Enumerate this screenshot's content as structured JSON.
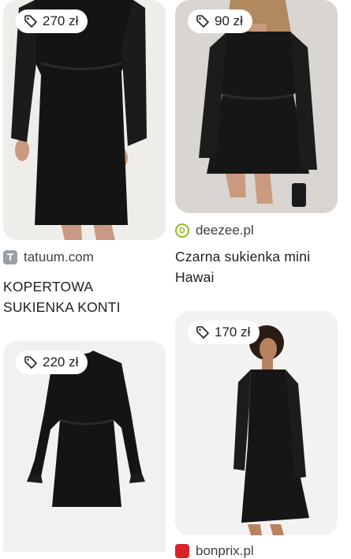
{
  "results": [
    {
      "price": "270 zł",
      "source": "tatuum.com",
      "title": "KOPERTOWA SUKIENKA KONTI",
      "favicon_color": "#9aa0a6"
    },
    {
      "price": "90 zł",
      "source": "deezee.pl",
      "title": "Czarna sukienka mini Hawai",
      "favicon_color": "#8fbf24"
    },
    {
      "price": "220 zł",
      "source": "",
      "title": ""
    },
    {
      "price": "170 zł",
      "source": "bonprix.pl",
      "title": "",
      "favicon_color": "#d8232a"
    }
  ],
  "icons": {
    "price_tag": "price-tag-icon",
    "tatuum": "tatuum-favicon-icon",
    "deezee": "deezee-favicon-icon",
    "bonprix": "bonprix-favicon-icon"
  },
  "colors": {
    "card_bg": "#efeeec",
    "dress": "#141414",
    "text": "#202124",
    "subtext": "#3c4043"
  }
}
